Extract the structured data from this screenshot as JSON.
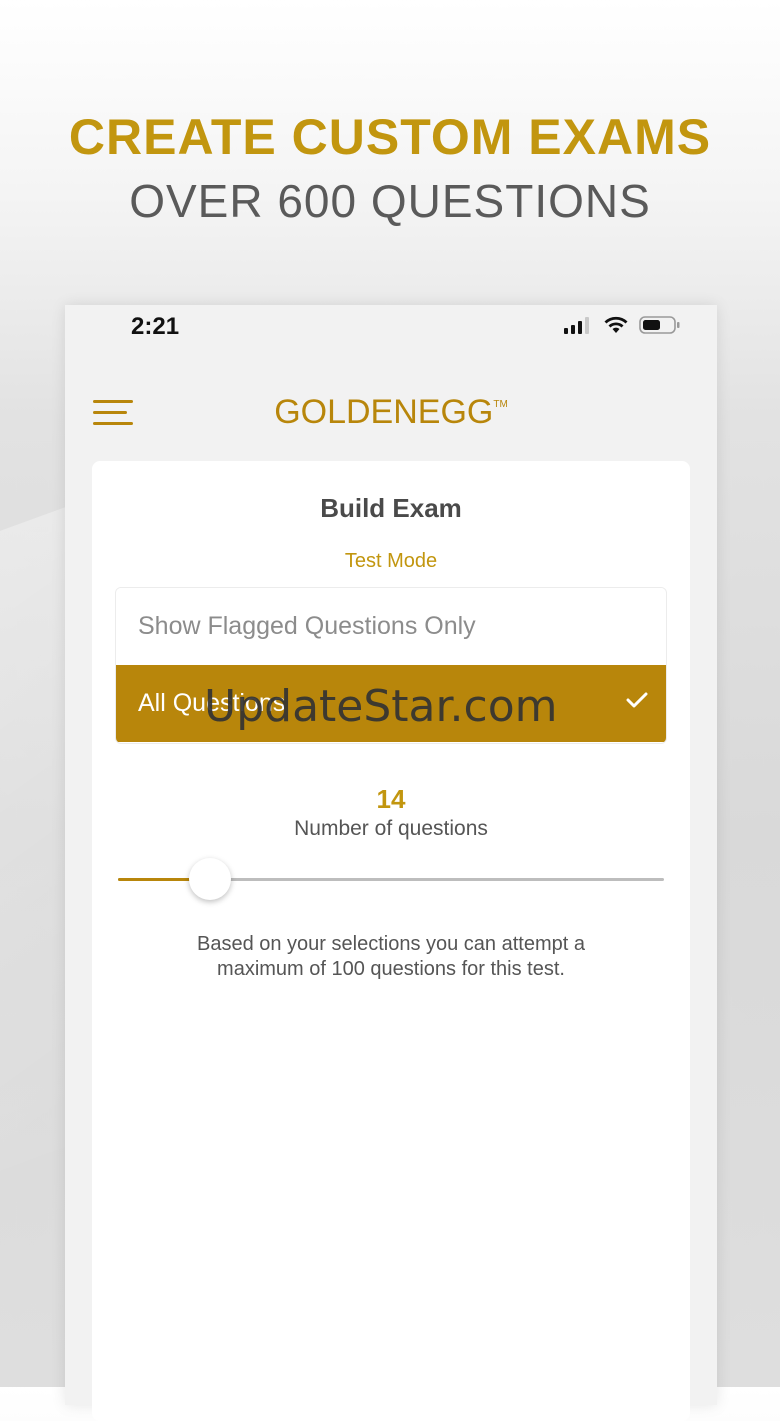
{
  "promo": {
    "headline": "CREATE CUSTOM EXAMS",
    "subheadline": "OVER 600 QUESTIONS"
  },
  "status_bar": {
    "time": "2:21",
    "icons": [
      "signal-icon",
      "wifi-icon",
      "battery-icon"
    ]
  },
  "app_bar": {
    "menu_icon": "hamburger-menu-icon",
    "logo_text": "GOLDENEGG",
    "logo_mark": "TM"
  },
  "build_exam": {
    "title": "Build Exam",
    "mode_label": "Test Mode",
    "options": [
      {
        "label": "Show Flagged Questions Only",
        "selected": false
      },
      {
        "label": "All Questions",
        "selected": true
      }
    ],
    "question_count": "14",
    "question_count_label": "Number of questions",
    "slider": {
      "value": 14,
      "min": 0,
      "max": 100
    },
    "info": "Based on your selections you can attempt a maximum of 100 questions for this test."
  },
  "watermark": "UpdateStar.com",
  "colors": {
    "accent": "#b8860b",
    "headline_gold": "#c2960f",
    "headline_grey": "#5a5a5a"
  }
}
